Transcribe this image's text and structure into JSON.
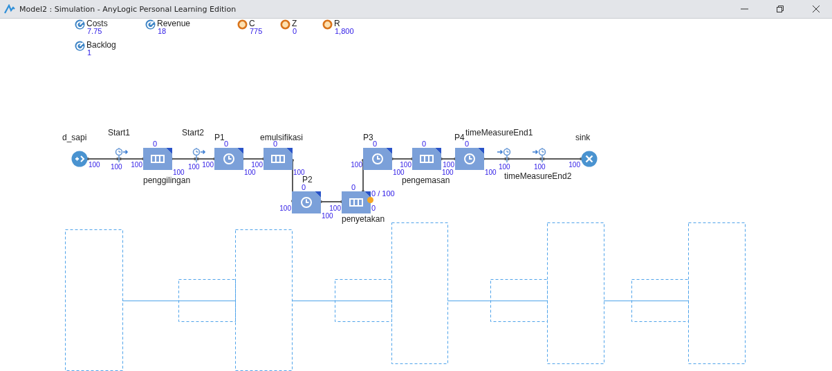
{
  "window": {
    "title": "Model2 : Simulation - AnyLogic Personal Learning Edition"
  },
  "variables": [
    {
      "kind": "statistic",
      "name": "Costs",
      "value": "7.75"
    },
    {
      "kind": "statistic",
      "name": "Revenue",
      "value": "18"
    },
    {
      "kind": "parameter",
      "name": "C",
      "value": "775"
    },
    {
      "kind": "parameter",
      "name": "Z",
      "value": "0"
    },
    {
      "kind": "parameter",
      "name": "R",
      "value": "1,800"
    },
    {
      "kind": "statistic",
      "name": "Backlog",
      "value": "1"
    }
  ],
  "blocks": [
    {
      "kind": "source",
      "name": "d_sapi",
      "out": "100",
      "flagged": false
    },
    {
      "kind": "timer_start",
      "name": "Start1",
      "count": "100",
      "flagged": false
    },
    {
      "kind": "queue",
      "name": "penggilingan",
      "count": "0",
      "in": "100",
      "out": "100",
      "flagged": false
    },
    {
      "kind": "timer_start",
      "name": "Start2",
      "count": "100",
      "flagged": false
    },
    {
      "kind": "delay",
      "name": "P1",
      "count": "0",
      "in": "100",
      "out": "100",
      "flagged": false
    },
    {
      "kind": "queue",
      "name": "emulsifikasi",
      "count": "0",
      "in": "100",
      "out": "100",
      "flagged": false
    },
    {
      "kind": "delay",
      "name": "P3",
      "count": "0",
      "in": "100",
      "out": "100",
      "flagged": false
    },
    {
      "kind": "queue",
      "name": "pengemasan",
      "count": "0",
      "in": "100",
      "out": "100",
      "flagged": false
    },
    {
      "kind": "delay",
      "name": "P4",
      "count": "0",
      "in": "100",
      "out": "100",
      "flagged": false
    },
    {
      "kind": "timer_end",
      "name": "timeMeasureEnd1",
      "count": "100",
      "flagged": false
    },
    {
      "kind": "timer_end",
      "name": "timeMeasureEnd2",
      "count": "100",
      "flagged": false
    },
    {
      "kind": "sink",
      "name": "sink",
      "in": "100",
      "flagged": false
    },
    {
      "kind": "delay",
      "name": "P2",
      "count": "0",
      "in": "100",
      "out": "100",
      "flagged": false
    },
    {
      "kind": "queue",
      "name": "penyetakan",
      "count": "0",
      "in": "100",
      "capacity": "0 / 100",
      "stored": "0",
      "flagged": true
    }
  ]
}
